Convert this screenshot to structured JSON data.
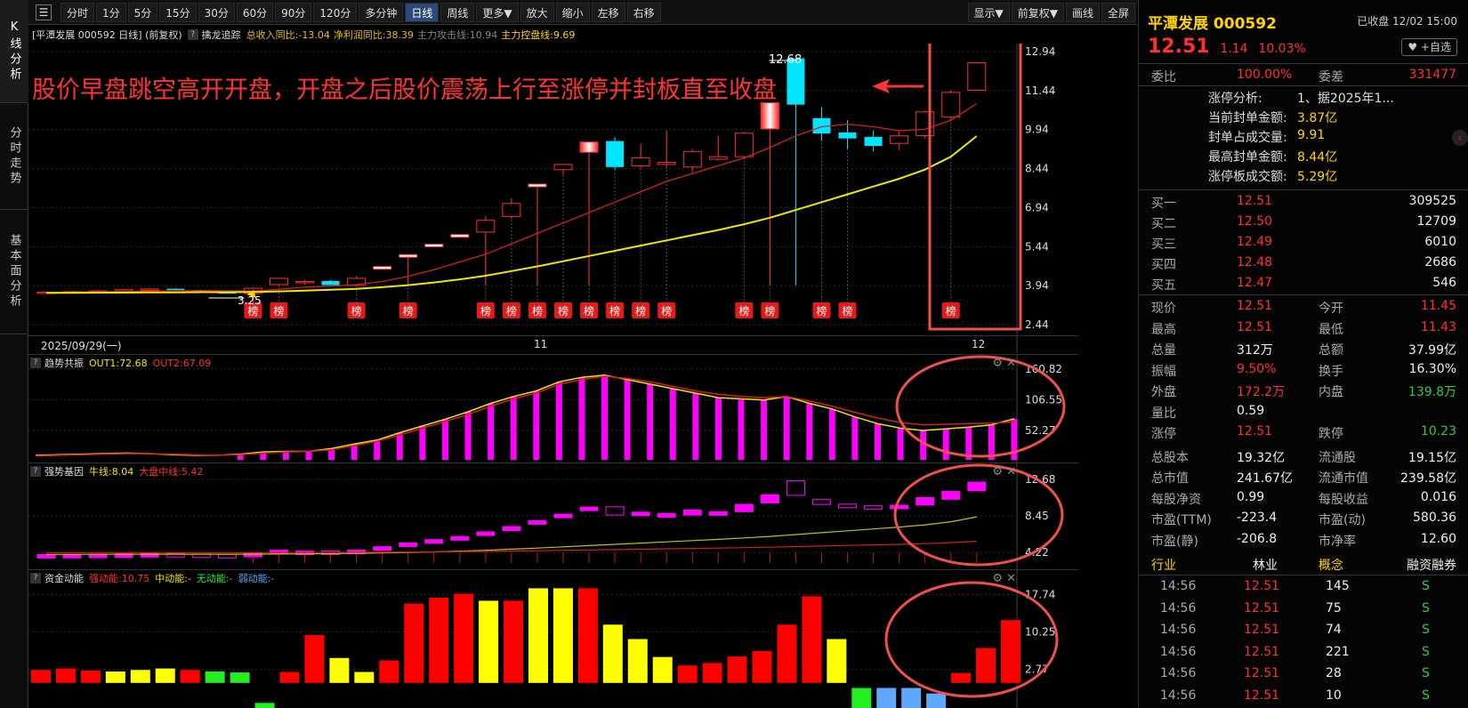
{
  "side_tabs": [
    "K线分析",
    "分时走势",
    "基本面分析"
  ],
  "toolbar": {
    "left": [
      "分时",
      "1分",
      "5分",
      "15分",
      "30分",
      "60分",
      "90分",
      "120分",
      "多分钟",
      "日线",
      "周线",
      "更多▼",
      "放大",
      "缩小",
      "左移",
      "右移"
    ],
    "active": "日线",
    "right": [
      "显示▼",
      "前复权▼",
      "画线",
      "全屏"
    ]
  },
  "infobar": {
    "title": "[平潭发展 000592 日线]  (前复权)",
    "indicator": "擒龙追踪",
    "stat1": "总收入同比:-13.04",
    "stat2": "净利润同比:38.39",
    "stat3": "主力攻击线:10.94",
    "stat4": "主力控盘线:9.69"
  },
  "annotation": {
    "text": "股价早盘跳空高开开盘，开盘之后股价震荡上行至涨停并封板直至收盘",
    "color": "#ff3333"
  },
  "main_chart": {
    "y_ticks": [
      "12.94",
      "11.44",
      "9.94",
      "8.44",
      "6.94",
      "5.44",
      "3.94",
      "2.44"
    ],
    "y_range": [
      2.44,
      12.94
    ],
    "high_label": "12.68",
    "low_label": "3.25",
    "x_labels": [
      "2025/09/29(一)",
      "11",
      "12"
    ],
    "badge_text": "榜",
    "badge_color": "#e21b1b",
    "ma1_color": "#d42020",
    "ma2_color": "#f2e600",
    "highlight_color": "#f0504a"
  },
  "chart_data": [
    {
      "type": "candlestick",
      "title": "平潭发展 000592 日线",
      "y_range": [
        2.44,
        12.94
      ],
      "candles": [
        {
          "o": 3.67,
          "c": 3.69,
          "h": 3.72,
          "l": 3.64
        },
        {
          "o": 3.68,
          "c": 3.71,
          "h": 3.74,
          "l": 3.66
        },
        {
          "o": 3.7,
          "c": 3.74,
          "h": 3.77,
          "l": 3.68
        },
        {
          "o": 3.73,
          "c": 3.78,
          "h": 3.81,
          "l": 3.71
        },
        {
          "o": 3.78,
          "c": 3.81,
          "h": 3.84,
          "l": 3.75
        },
        {
          "o": 3.82,
          "c": 3.77,
          "h": 3.85,
          "l": 3.74
        },
        {
          "o": 3.76,
          "c": 3.72,
          "h": 3.79,
          "l": 3.7
        },
        {
          "o": 3.7,
          "c": 3.63,
          "h": 3.72,
          "l": 3.55
        },
        {
          "o": 3.64,
          "c": 3.84,
          "h": 3.88,
          "l": 3.25
        },
        {
          "o": 3.98,
          "c": 4.22,
          "h": 4.22,
          "l": 3.95
        },
        {
          "o": 4.05,
          "c": 4.1,
          "h": 4.16,
          "l": 3.98
        },
        {
          "o": 4.12,
          "c": 3.96,
          "h": 4.16,
          "l": 3.9
        },
        {
          "o": 3.95,
          "c": 4.22,
          "h": 4.3,
          "l": 3.92
        },
        {
          "o": 4.64,
          "c": 4.64,
          "h": 4.64,
          "l": 4.64
        },
        {
          "o": 5.1,
          "c": 5.1,
          "h": 5.1,
          "l": 3.95
        },
        {
          "o": 5.5,
          "c": 5.5,
          "h": 5.5,
          "l": 5.5
        },
        {
          "o": 5.87,
          "c": 5.87,
          "h": 5.87,
          "l": 5.87
        },
        {
          "o": 6.0,
          "c": 6.45,
          "h": 6.6,
          "l": 3.95
        },
        {
          "o": 6.6,
          "c": 7.1,
          "h": 7.3,
          "l": 6.5
        },
        {
          "o": 7.81,
          "c": 7.81,
          "h": 7.81,
          "l": 3.95
        },
        {
          "o": 8.4,
          "c": 8.6,
          "h": 8.6,
          "l": 8.2
        },
        {
          "o": 9.07,
          "c": 9.46,
          "h": 9.46,
          "l": 3.95
        },
        {
          "o": 9.5,
          "c": 8.5,
          "h": 9.65,
          "l": 8.4
        },
        {
          "o": 8.55,
          "c": 8.85,
          "h": 9.4,
          "l": 8.45
        },
        {
          "o": 8.6,
          "c": 8.68,
          "h": 9.9,
          "l": 8.5
        },
        {
          "o": 8.5,
          "c": 9.1,
          "h": 9.2,
          "l": 8.3
        },
        {
          "o": 8.8,
          "c": 8.9,
          "h": 9.7,
          "l": 8.75
        },
        {
          "o": 8.9,
          "c": 9.8,
          "h": 9.85,
          "l": 8.8
        },
        {
          "o": 9.97,
          "c": 10.97,
          "h": 10.97,
          "l": 3.95
        },
        {
          "o": 12.68,
          "c": 10.9,
          "h": 12.68,
          "l": 3.95
        },
        {
          "o": 10.38,
          "c": 9.79,
          "h": 10.8,
          "l": 9.5
        },
        {
          "o": 9.83,
          "c": 9.6,
          "h": 10.3,
          "l": 9.2
        },
        {
          "o": 9.66,
          "c": 9.31,
          "h": 9.9,
          "l": 9.1
        },
        {
          "o": 9.41,
          "c": 9.7,
          "h": 9.9,
          "l": 9.15
        },
        {
          "o": 9.71,
          "c": 10.62,
          "h": 10.67,
          "l": 9.6
        },
        {
          "o": 10.42,
          "c": 11.37,
          "h": 11.45,
          "l": 10.3
        },
        {
          "o": 11.45,
          "c": 12.51,
          "h": 12.51,
          "l": 11.43
        }
      ],
      "ma_short": [
        3.68,
        3.69,
        3.7,
        3.72,
        3.73,
        3.74,
        3.75,
        3.74,
        3.73,
        3.8,
        3.88,
        3.92,
        3.98,
        4.1,
        4.3,
        4.55,
        4.85,
        5.15,
        5.55,
        5.95,
        6.35,
        6.75,
        7.15,
        7.55,
        7.95,
        8.25,
        8.55,
        8.85,
        9.25,
        9.7,
        10.05,
        10.15,
        10.05,
        9.9,
        9.95,
        10.3,
        10.94
      ],
      "ma_long": [
        3.66,
        3.66,
        3.67,
        3.67,
        3.68,
        3.68,
        3.69,
        3.69,
        3.7,
        3.72,
        3.75,
        3.78,
        3.82,
        3.88,
        3.96,
        4.06,
        4.18,
        4.32,
        4.5,
        4.68,
        4.88,
        5.08,
        5.28,
        5.48,
        5.68,
        5.88,
        6.08,
        6.3,
        6.55,
        6.85,
        7.15,
        7.45,
        7.75,
        8.05,
        8.4,
        8.9,
        9.69
      ],
      "badges_on": [
        8,
        9,
        12,
        14,
        17,
        18,
        19,
        20,
        21,
        22,
        23,
        24,
        27,
        28,
        30,
        31,
        35
      ]
    },
    {
      "type": "bar",
      "title": "趋势共振",
      "series": [
        {
          "name": "OUT1",
          "values": [
            8,
            9,
            10,
            11,
            12,
            11,
            9,
            8,
            8,
            10,
            14,
            15,
            15,
            20,
            28,
            35,
            48,
            60,
            72,
            85,
            100,
            112,
            122,
            138,
            146,
            150,
            142,
            134,
            126,
            118,
            110,
            108,
            106,
            112,
            100,
            90,
            76,
            64,
            56,
            52,
            55,
            58,
            62,
            72.68
          ]
        },
        {
          "name": "OUT2",
          "values": [
            7,
            8,
            9,
            10,
            11,
            11,
            10,
            9,
            8,
            9,
            12,
            14,
            15,
            18,
            25,
            33,
            44,
            56,
            68,
            80,
            95,
            108,
            118,
            134,
            142,
            148,
            144,
            138,
            130,
            122,
            116,
            112,
            110,
            112,
            104,
            95,
            84,
            74,
            66,
            62,
            63,
            64,
            65,
            67.09
          ]
        }
      ],
      "legend": {
        "OUT1": "OUT1:72.68",
        "OUT2": "OUT2:67.09"
      },
      "y_ticks": [
        "160.82",
        "106.55",
        "52.27"
      ],
      "y_range": [
        0,
        170
      ]
    },
    {
      "type": "candlestick",
      "title": "强势基因",
      "legend": {
        "bull": "牛线:8.04",
        "market": "大盘中线:5.42"
      },
      "y_ticks": [
        "12.68",
        "8.45",
        "4.22"
      ],
      "y_range": [
        3.0,
        13.5
      ]
    },
    {
      "type": "bar",
      "title": "资金动能",
      "legend": {
        "strong": "强动能:10.75",
        "mid": "中动能:-",
        "none": "无动能:-",
        "weak": "弱动能:-"
      },
      "values": [
        2.6,
        2.9,
        2.5,
        2.3,
        2.6,
        2.9,
        2.6,
        2.3,
        2.1,
        -1.2,
        2.2,
        9.6,
        5.0,
        2.2,
        4.5,
        15.9,
        17.1,
        17.9,
        16.5,
        16.5,
        19.0,
        19.0,
        19.0,
        11.7,
        8.8,
        5.2,
        3.5,
        4.0,
        5.3,
        6.4,
        11.7,
        17.4,
        8.8,
        -4.2,
        -4.2,
        -4.2,
        -3.1,
        2.0,
        7.0,
        12.6
      ],
      "colors": [
        "r",
        "r",
        "r",
        "y",
        "y",
        "y",
        "r",
        "g",
        "g",
        "g",
        "r",
        "r",
        "y",
        "y",
        "r",
        "r",
        "r",
        "r",
        "y",
        "r",
        "y",
        "y",
        "r",
        "y",
        "y",
        "y",
        "r",
        "r",
        "r",
        "r",
        "r",
        "r",
        "y",
        "g",
        "b",
        "b",
        "b",
        "r",
        "r",
        "r"
      ],
      "y_ticks": [
        "17.74",
        "10.25",
        "2.77"
      ],
      "y_range": [
        -4.5,
        20.5
      ]
    }
  ],
  "osc_colors": {
    "bar": "#ff00ff",
    "line1": "#f2e600",
    "line2": "#d42020"
  },
  "fund_colors": {
    "r": "#ff0000",
    "y": "#ffff00",
    "g": "#22ee22",
    "b": "#5fa8ff"
  },
  "right_panel": {
    "name": "平潭发展",
    "code": "000592",
    "status": "已收盘 12/02 15:00",
    "price": "12.51",
    "change": "1.14",
    "pct": "10.03%",
    "watch": "♥ +自选",
    "weibi_label": "委比",
    "weibi": "100.00%",
    "weicha_label": "委差",
    "weicha": "331477",
    "limit_info": [
      {
        "label": "涨停分析:",
        "value": "1、据2025年1..."
      },
      {
        "label": "当前封单金额:",
        "value": "3.87亿"
      },
      {
        "label": "封单占成交量:",
        "value": "9.91"
      },
      {
        "label": "最高封单金额:",
        "value": "8.44亿"
      },
      {
        "label": "涨停板成交额:",
        "value": "5.29亿"
      }
    ],
    "buys": [
      {
        "label": "买一",
        "price": "12.51",
        "vol": "309525"
      },
      {
        "label": "买二",
        "price": "12.50",
        "vol": "12709"
      },
      {
        "label": "买三",
        "price": "12.49",
        "vol": "6010"
      },
      {
        "label": "买四",
        "price": "12.48",
        "vol": "2686"
      },
      {
        "label": "买五",
        "price": "12.47",
        "vol": "546"
      }
    ],
    "stats": [
      {
        "l1": "现价",
        "v1": "12.51",
        "c1": "red",
        "l2": "今开",
        "v2": "11.45",
        "c2": "red"
      },
      {
        "l1": "最高",
        "v1": "12.51",
        "c1": "red",
        "l2": "最低",
        "v2": "11.43",
        "c2": "red"
      },
      {
        "l1": "总量",
        "v1": "312万",
        "c1": "white",
        "l2": "总额",
        "v2": "37.99亿",
        "c2": "white"
      },
      {
        "l1": "振幅",
        "v1": "9.50%",
        "c1": "red",
        "l2": "换手",
        "v2": "16.30%",
        "c2": "white"
      },
      {
        "l1": "外盘",
        "v1": "172.2万",
        "c1": "red",
        "l2": "内盘",
        "v2": "139.8万",
        "c2": "green"
      },
      {
        "l1": "量比",
        "v1": "0.59",
        "c1": "white",
        "l2": "",
        "v2": "",
        "c2": "white"
      },
      {
        "l1": "涨停",
        "v1": "12.51",
        "c1": "red",
        "l2": "跌停",
        "v2": "10.23",
        "c2": "green"
      },
      {
        "l1": "总股本",
        "v1": "19.32亿",
        "c1": "white",
        "l2": "流通股",
        "v2": "19.15亿",
        "c2": "white"
      },
      {
        "l1": "总市值",
        "v1": "241.67亿",
        "c1": "white",
        "l2": "流通市值",
        "v2": "239.58亿",
        "c2": "white"
      },
      {
        "l1": "每股净资",
        "v1": "0.99",
        "c1": "white",
        "l2": "每股收益",
        "v2": "0.016",
        "c2": "white"
      },
      {
        "l1": "市盈(TTM)",
        "v1": "-223.4",
        "c1": "white",
        "l2": "市盈(动)",
        "v2": "580.36",
        "c2": "white"
      },
      {
        "l1": "市盈(静)",
        "v1": "-206.8",
        "c1": "white",
        "l2": "市净率",
        "v2": "12.60",
        "c2": "white"
      }
    ],
    "tags": {
      "industry_label": "行业",
      "industry": "林业",
      "concept_label": "概念",
      "margin": "融资融券"
    },
    "ticks": [
      {
        "time": "14:56",
        "price": "12.51",
        "vol": "145",
        "dir": "S"
      },
      {
        "time": "14:56",
        "price": "12.51",
        "vol": "75",
        "dir": "S"
      },
      {
        "time": "14:56",
        "price": "12.51",
        "vol": "74",
        "dir": "S"
      },
      {
        "time": "14:56",
        "price": "12.51",
        "vol": "221",
        "dir": "S"
      },
      {
        "time": "14:56",
        "price": "12.51",
        "vol": "28",
        "dir": "S"
      },
      {
        "time": "14:56",
        "price": "12.51",
        "vol": "10",
        "dir": "S"
      }
    ]
  }
}
